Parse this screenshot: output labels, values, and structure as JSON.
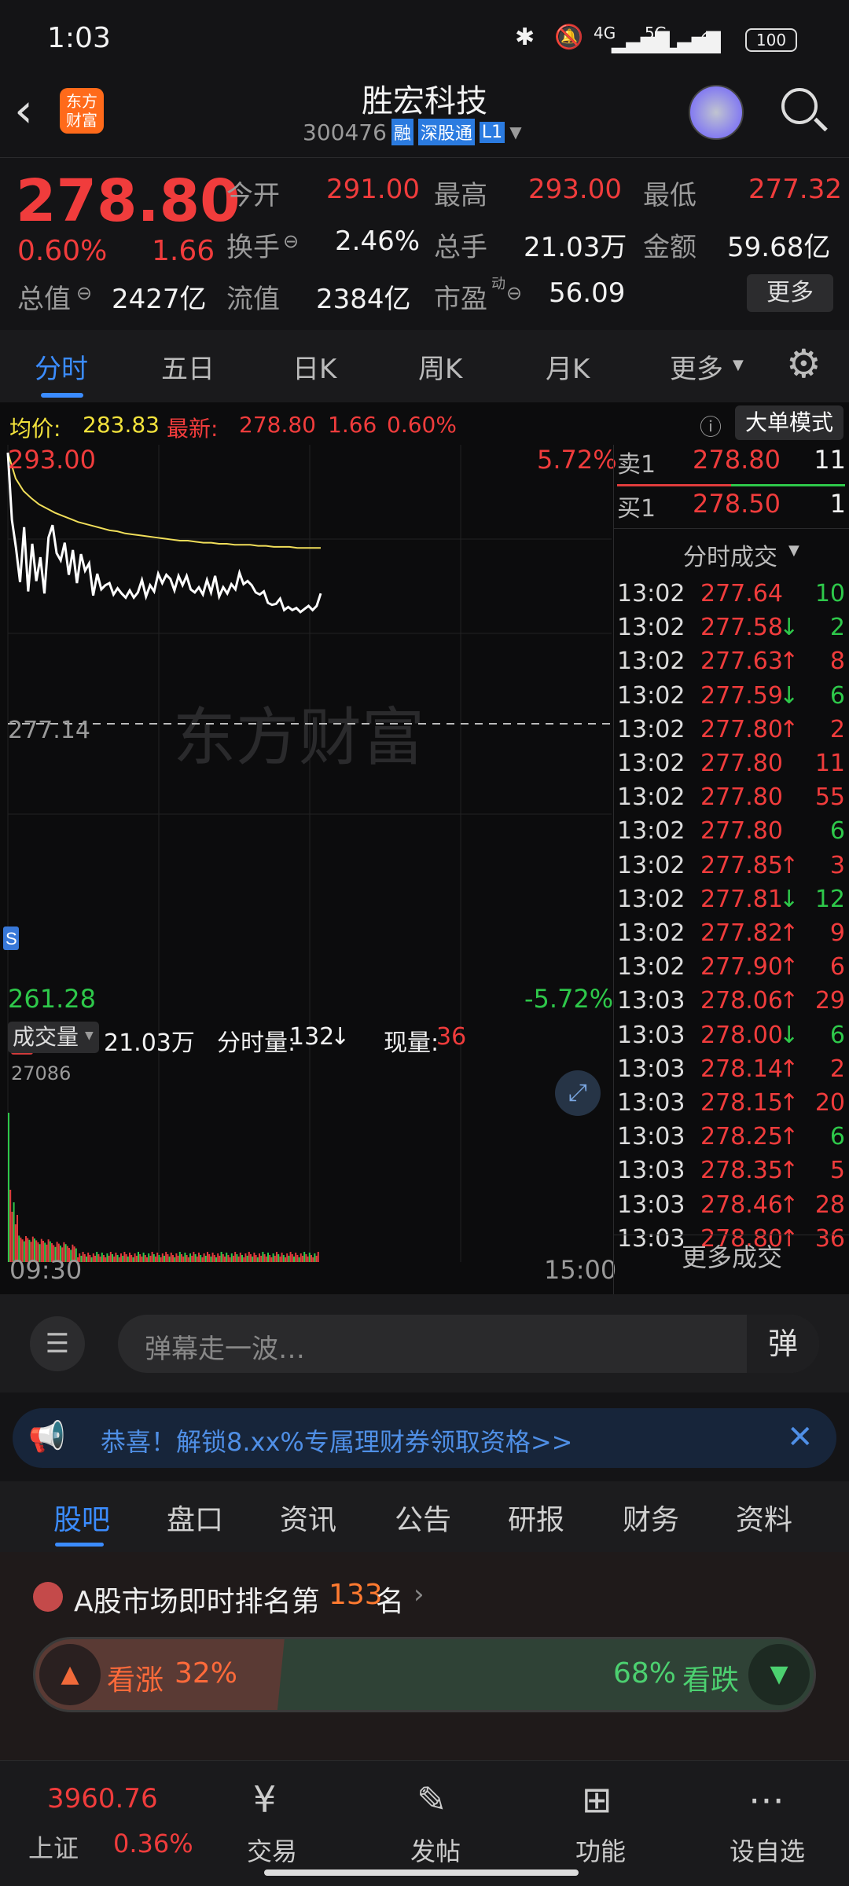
{
  "status_bar": {
    "time": "1:03",
    "battery": "100",
    "network": [
      "4G",
      "5G"
    ]
  },
  "header": {
    "title": "胜宏科技",
    "code": "300476",
    "badges": [
      "融",
      "深股通",
      "L1"
    ],
    "logo_text": "东方财富"
  },
  "quote": {
    "price": "278.80",
    "change_pct": "0.60%",
    "change": "1.66",
    "open_label": "今开",
    "open": "291.00",
    "high_label": "最高",
    "high": "293.00",
    "low_label": "最低",
    "low": "277.32",
    "turnover_label": "换手",
    "turnover": "2.46%",
    "vol_label": "总手",
    "vol": "21.03万",
    "amount_label": "金额",
    "amount": "59.68亿",
    "mktcap_label": "总值",
    "mktcap": "2427亿",
    "float_label": "流值",
    "float": "2384亿",
    "pe_label": "市盈",
    "pe_sup": "动",
    "pe": "56.09",
    "more": "更多"
  },
  "tabs": {
    "items": [
      "分时",
      "五日",
      "日K",
      "周K",
      "月K",
      "更多"
    ],
    "active": 0
  },
  "chart_info": {
    "avg_label": "均价:",
    "avg": "283.83",
    "latest_label": "最新:",
    "latest": "278.80",
    "chg": "1.66",
    "pct": "0.60%",
    "mode_btn": "大单模式"
  },
  "chart_data": {
    "type": "line",
    "series": [],
    "y_top": "293.00",
    "y_bottom": "261.28",
    "y_pct_top": "5.72%",
    "y_pct_bottom": "-5.72%",
    "prev_close": "277.14",
    "x_start": "09:30",
    "x_end": "15:00",
    "price": [
      293.0,
      286.5,
      283.8,
      280.5,
      285.8,
      279.6,
      284.2,
      280.6,
      282.9,
      279.4,
      284.8,
      286.0,
      283.3,
      282.6,
      284.3,
      281.2,
      283.6,
      280.4,
      283.2,
      281.6,
      282.3,
      279.2,
      281.3,
      279.8,
      280.2,
      280.4,
      279.3,
      279.9,
      279.4,
      279.0,
      279.7,
      279.0,
      279.5,
      280.7,
      279.1,
      280.2,
      279.6,
      281.3,
      280.4,
      281.2,
      280.8,
      279.7,
      281.1,
      280.2,
      281.1,
      279.8,
      279.5,
      280.0,
      279.3,
      280.7,
      279.5,
      281.1,
      279.1,
      280.0,
      279.4,
      280.3,
      279.8,
      281.4,
      280.3,
      280.6,
      280.2,
      279.5,
      279.3,
      279.6,
      278.5,
      278.3,
      278.4,
      278.9,
      277.8,
      278.1,
      277.8,
      278.0,
      277.6,
      277.9,
      278.2,
      277.8,
      278.2,
      279.4
    ],
    "avg": [
      293.0,
      290.5,
      289.3,
      288.6,
      288.0,
      287.6,
      287.2,
      286.9,
      286.6,
      286.3,
      286.1,
      285.9,
      285.7,
      285.5,
      285.4,
      285.2,
      285.1,
      285.0,
      284.9,
      284.8,
      284.7,
      284.6,
      284.5,
      284.5,
      284.4,
      284.3,
      284.3,
      284.2,
      284.2,
      284.1,
      284.1,
      284.1,
      284.0,
      284.0,
      283.9,
      283.9,
      283.9,
      283.8,
      283.8,
      283.8,
      283.8
    ],
    "volume_label": "成交量",
    "volume_total": "21.03万",
    "minute_vol_label": "分时量:",
    "minute_vol": "132",
    "now_vol_label": "现量:",
    "now_vol": "36",
    "vol_max": "27086"
  },
  "order_book": {
    "sell_label": "卖1",
    "sell_price": "278.80",
    "sell_qty": "11",
    "buy_label": "买1",
    "buy_price": "278.50",
    "buy_qty": "1",
    "trades_title": "分时成交",
    "more_trades": "更多成交"
  },
  "trades": [
    {
      "t": "13:02",
      "p": "277.64",
      "a": "",
      "v": "10",
      "vc": "dn"
    },
    {
      "t": "13:02",
      "p": "277.58",
      "a": "↓",
      "v": "2",
      "vc": "dn"
    },
    {
      "t": "13:02",
      "p": "277.63",
      "a": "↑",
      "v": "8",
      "vc": "up"
    },
    {
      "t": "13:02",
      "p": "277.59",
      "a": "↓",
      "v": "6",
      "vc": "dn"
    },
    {
      "t": "13:02",
      "p": "277.80",
      "a": "↑",
      "v": "2",
      "vc": "up"
    },
    {
      "t": "13:02",
      "p": "277.80",
      "a": "",
      "v": "11",
      "vc": "up"
    },
    {
      "t": "13:02",
      "p": "277.80",
      "a": "",
      "v": "55",
      "vc": "up"
    },
    {
      "t": "13:02",
      "p": "277.80",
      "a": "",
      "v": "6",
      "vc": "dn"
    },
    {
      "t": "13:02",
      "p": "277.85",
      "a": "↑",
      "v": "3",
      "vc": "up"
    },
    {
      "t": "13:02",
      "p": "277.81",
      "a": "↓",
      "v": "12",
      "vc": "dn"
    },
    {
      "t": "13:02",
      "p": "277.82",
      "a": "↑",
      "v": "9",
      "vc": "up"
    },
    {
      "t": "13:02",
      "p": "277.90",
      "a": "↑",
      "v": "6",
      "vc": "up"
    },
    {
      "t": "13:03",
      "p": "278.06",
      "a": "↑",
      "v": "29",
      "vc": "up"
    },
    {
      "t": "13:03",
      "p": "278.00",
      "a": "↓",
      "v": "6",
      "vc": "dn"
    },
    {
      "t": "13:03",
      "p": "278.14",
      "a": "↑",
      "v": "2",
      "vc": "up"
    },
    {
      "t": "13:03",
      "p": "278.15",
      "a": "↑",
      "v": "20",
      "vc": "up"
    },
    {
      "t": "13:03",
      "p": "278.25",
      "a": "↑",
      "v": "6",
      "vc": "dn"
    },
    {
      "t": "13:03",
      "p": "278.35",
      "a": "↑",
      "v": "5",
      "vc": "up"
    },
    {
      "t": "13:03",
      "p": "278.46",
      "a": "↑",
      "v": "28",
      "vc": "up"
    },
    {
      "t": "13:03",
      "p": "278.80",
      "a": "↑",
      "v": "36",
      "vc": "up"
    }
  ],
  "danmu": {
    "placeholder": "弹幕走一波…",
    "send": "弹"
  },
  "promo": {
    "text": "恭喜！解锁8.xx%专属理财券领取资格>>"
  },
  "section_tabs": {
    "items": [
      "股吧",
      "盘口",
      "资讯",
      "公告",
      "研报",
      "财务",
      "资料"
    ],
    "active": 0
  },
  "rank": {
    "prefix": "A股市场即时排名第",
    "num": "133",
    "suffix": "名"
  },
  "sentiment": {
    "up_label": "看涨",
    "up_pct": "32%",
    "down_label": "看跌",
    "down_pct": "68%",
    "up_ratio": 0.32
  },
  "bottom_nav": {
    "index_value": "3960.76",
    "index_name": "上证",
    "index_pct": "0.36%",
    "items": [
      "交易",
      "发帖",
      "功能",
      "设自选"
    ]
  }
}
